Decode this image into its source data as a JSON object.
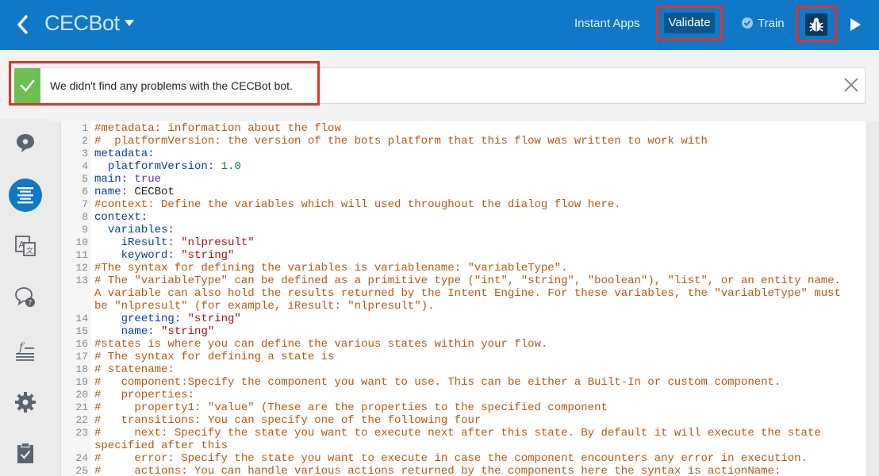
{
  "header": {
    "title": "CECBot",
    "instant_apps": "Instant Apps",
    "validate": "Validate",
    "train": "Train"
  },
  "alert": {
    "message": "We didn't find any problems with the CECBot bot."
  },
  "editor": {
    "lines": [
      {
        "n": "1",
        "t": "#metadata: information about the flow",
        "c": true
      },
      {
        "n": "2",
        "t": "#  platformVersion: the version of the bots platform that this flow was written to work with",
        "c": true
      },
      {
        "n": "3",
        "t": "metadata:"
      },
      {
        "n": "4",
        "t": "  platformVersion: 1.0"
      },
      {
        "n": "5",
        "t": "main: true"
      },
      {
        "n": "6",
        "t": "name: CECBot"
      },
      {
        "n": "7",
        "t": "#context: Define the variables which will used throughout the dialog flow here.",
        "c": true
      },
      {
        "n": "8",
        "t": "context:"
      },
      {
        "n": "9",
        "t": "  variables:"
      },
      {
        "n": "10",
        "t": "    iResult: \"nlpresult\""
      },
      {
        "n": "11",
        "t": "    keyword: \"string\""
      },
      {
        "n": "12",
        "t": "#The syntax for defining the variables is variablename: \"variableType\".",
        "c": true
      },
      {
        "n": "13",
        "t": "# The \"variableType\" can be defined as a primitive type (\"int\", \"string\", \"boolean\"), \"list\", or an entity name. A variable can also hold the results returned by the Intent Engine. For these variables, the \"variableType\" must be \"nlpresult\" (for example, iResult: \"nlpresult\").",
        "c": true
      },
      {
        "n": "14",
        "t": "    greeting: \"string\""
      },
      {
        "n": "15",
        "t": "    name: \"string\""
      },
      {
        "n": "16",
        "t": "#states is where you can define the various states within your flow.",
        "c": true
      },
      {
        "n": "17",
        "t": "# The syntax for defining a state is",
        "c": true
      },
      {
        "n": "18",
        "t": "# statename:",
        "c": true
      },
      {
        "n": "19",
        "t": "#   component:Specify the component you want to use. This can be either a Built-In or custom component.",
        "c": true
      },
      {
        "n": "20",
        "t": "#   properties:",
        "c": true
      },
      {
        "n": "21",
        "t": "#     property1: \"value\" (These are the properties to the specified component",
        "c": true
      },
      {
        "n": "22",
        "t": "#   transitions: You can specify one of the following four",
        "c": true
      },
      {
        "n": "23",
        "t": "#     next: Specify the state you want to execute next after this state. By default it will execute the state specified after this",
        "c": true
      },
      {
        "n": "24",
        "t": "#     error: Specify the state you want to execute in case the component encounters any error in execution.",
        "c": true
      },
      {
        "n": "25",
        "t": "#     actions: You can handle various actions returned by the components here the syntax is actionName:",
        "c": true
      }
    ]
  },
  "colors": {
    "header_bg": "#0f78c7",
    "highlight": "#e0322c",
    "success": "#6cbf52",
    "comment": "#b05a12",
    "key": "#0b3f9c",
    "string": "#a11515"
  },
  "sidebar": {
    "icons": [
      "chat-bubble-icon",
      "flow-list-icon",
      "translate-icon",
      "faq-icon",
      "function-icon",
      "gear-icon",
      "clipboard-check-icon"
    ]
  }
}
